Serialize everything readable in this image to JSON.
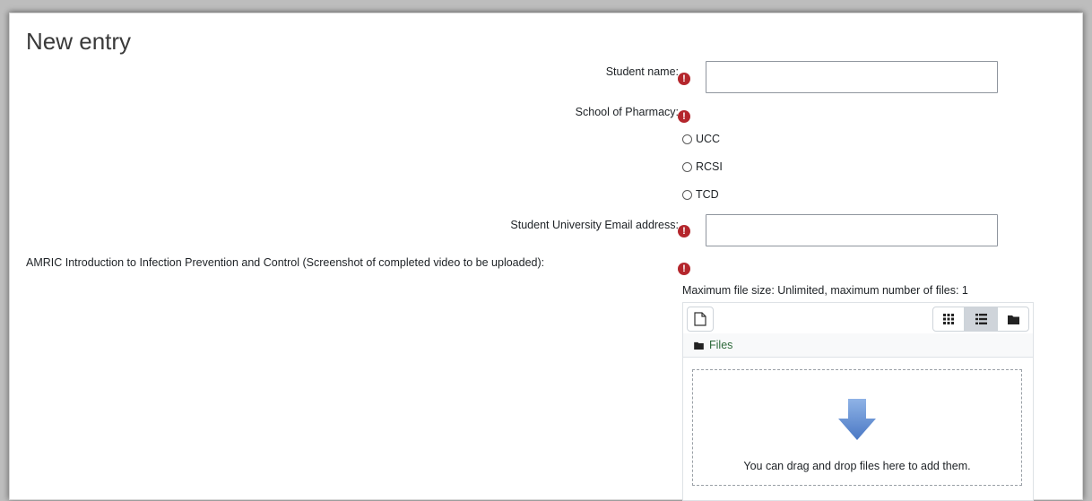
{
  "form": {
    "title": "New entry",
    "fields": {
      "student_name": {
        "label": "Student name:"
      },
      "school": {
        "label": "School of Pharmacy:",
        "options": [
          "UCC",
          "RCSI",
          "TCD"
        ]
      },
      "email": {
        "label": "Student University Email address:"
      },
      "amric": {
        "label": "AMRIC Introduction to Infection Prevention and Control (Screenshot of completed video to be uploaded):",
        "hint": "Maximum file size: Unlimited, maximum number of files: 1"
      }
    },
    "required_icon": "!",
    "filepicker": {
      "path_label": "Files",
      "drop_text": "You can drag and drop files here to add them.",
      "icons": {
        "add": "file-icon",
        "grid": "grid-view-icon",
        "list": "list-view-icon",
        "tree": "folder-view-icon",
        "path": "folder-icon",
        "drop": "arrow-down-icon"
      }
    },
    "colors": {
      "required": "#b4262c",
      "arrow": "#5d8ccf",
      "link": "#2f6b3c"
    }
  }
}
